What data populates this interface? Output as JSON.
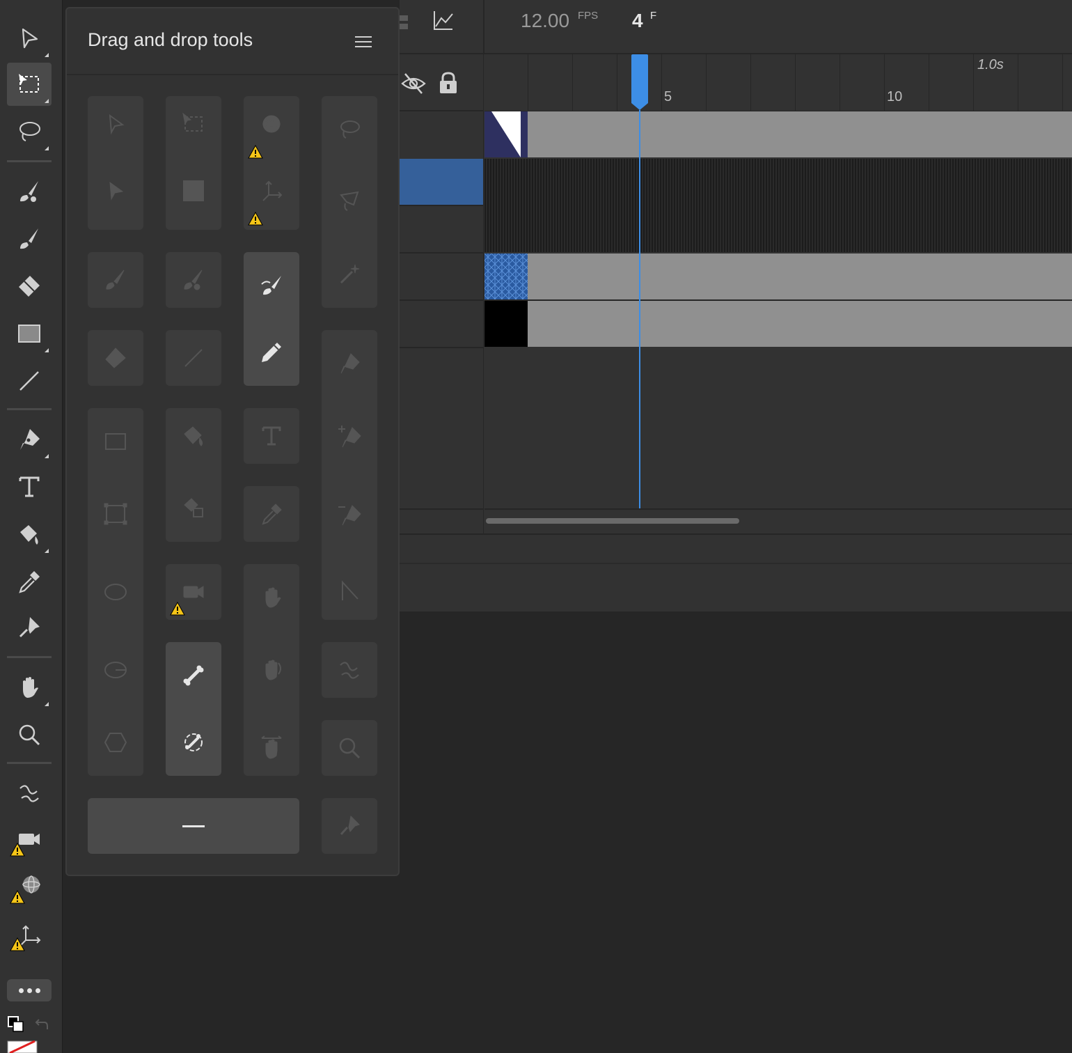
{
  "panel": {
    "title": "Drag and drop tools",
    "menu_icon": "hamburger-menu-icon"
  },
  "timeline": {
    "fps_value": "12.00",
    "fps_unit": "FPS",
    "frame_value": "4",
    "frame_unit": "F",
    "ruler_labels": [
      "5",
      "10"
    ],
    "ruler_time": "1.0s",
    "current_frame": 4
  },
  "toolbar": {
    "tools": [
      "selection-tool-icon",
      "free-transform-tool-icon",
      "lasso-tool-icon",
      "fluid-brush-tool-icon",
      "paint-brush-tool-icon",
      "eraser-tool-icon",
      "rectangle-tool-icon",
      "line-tool-icon",
      "pen-tool-icon",
      "text-tool-icon",
      "paint-bucket-tool-icon",
      "eyedropper-tool-icon",
      "asset-warp-tool-icon",
      "hand-tool-icon",
      "zoom-tool-icon",
      "bone-tool-icon",
      "camera-tool-icon",
      "3d-rotation-tool-icon",
      "3d-translation-tool-icon"
    ]
  },
  "colors": {
    "accent": "#3d8ee6",
    "selected_layer": "#35609a",
    "warning": "#f5c518"
  }
}
